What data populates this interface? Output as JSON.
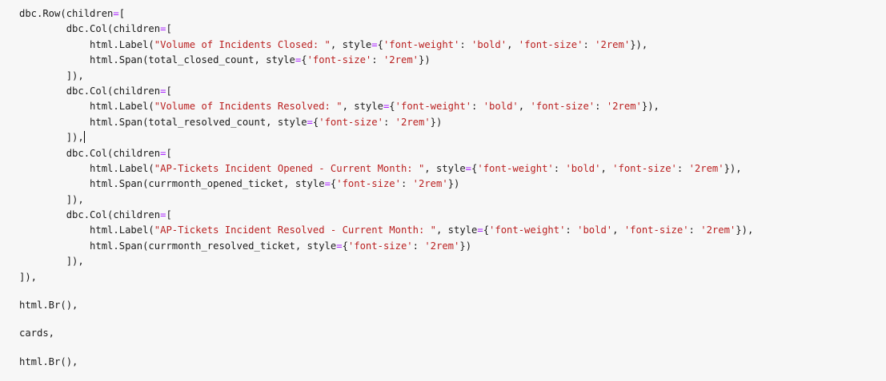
{
  "colors": {
    "background": "#f7f7f7",
    "text": "#1a1a1a",
    "string": "#ba2121",
    "operator": "#aa22ff"
  },
  "code_lines": [
    [
      {
        "t": "dbc.Row(children"
      },
      {
        "t": "=",
        "c": "op"
      },
      {
        "t": "["
      }
    ],
    [
      {
        "t": "        dbc.Col(children"
      },
      {
        "t": "=",
        "c": "op"
      },
      {
        "t": "["
      }
    ],
    [
      {
        "t": "            html.Label("
      },
      {
        "t": "\"Volume of Incidents Closed: \"",
        "c": "str"
      },
      {
        "t": ", style"
      },
      {
        "t": "=",
        "c": "op"
      },
      {
        "t": "{"
      },
      {
        "t": "'font-weight'",
        "c": "str"
      },
      {
        "t": ": "
      },
      {
        "t": "'bold'",
        "c": "str"
      },
      {
        "t": ", "
      },
      {
        "t": "'font-size'",
        "c": "str"
      },
      {
        "t": ": "
      },
      {
        "t": "'2rem'",
        "c": "str"
      },
      {
        "t": "}),"
      }
    ],
    [
      {
        "t": "            html.Span(total_closed_count, style"
      },
      {
        "t": "=",
        "c": "op"
      },
      {
        "t": "{"
      },
      {
        "t": "'font-size'",
        "c": "str"
      },
      {
        "t": ": "
      },
      {
        "t": "'2rem'",
        "c": "str"
      },
      {
        "t": "})"
      }
    ],
    [
      {
        "t": "        ]),"
      }
    ],
    [
      {
        "t": "        dbc.Col(children"
      },
      {
        "t": "=",
        "c": "op"
      },
      {
        "t": "["
      }
    ],
    [
      {
        "t": "            html.Label("
      },
      {
        "t": "\"Volume of Incidents Resolved: \"",
        "c": "str"
      },
      {
        "t": ", style"
      },
      {
        "t": "=",
        "c": "op"
      },
      {
        "t": "{"
      },
      {
        "t": "'font-weight'",
        "c": "str"
      },
      {
        "t": ": "
      },
      {
        "t": "'bold'",
        "c": "str"
      },
      {
        "t": ", "
      },
      {
        "t": "'font-size'",
        "c": "str"
      },
      {
        "t": ": "
      },
      {
        "t": "'2rem'",
        "c": "str"
      },
      {
        "t": "}),"
      }
    ],
    [
      {
        "t": "            html.Span(total_resolved_count, style"
      },
      {
        "t": "=",
        "c": "op"
      },
      {
        "t": "{"
      },
      {
        "t": "'font-size'",
        "c": "str"
      },
      {
        "t": ": "
      },
      {
        "t": "'2rem'",
        "c": "str"
      },
      {
        "t": "})"
      }
    ],
    [
      {
        "t": "        ]),"
      },
      {
        "caret": true
      }
    ],
    [
      {
        "t": "        dbc.Col(children"
      },
      {
        "t": "=",
        "c": "op"
      },
      {
        "t": "["
      }
    ],
    [
      {
        "t": "            html.Label("
      },
      {
        "t": "\"AP-Tickets Incident Opened - Current Month: \"",
        "c": "str"
      },
      {
        "t": ", style"
      },
      {
        "t": "=",
        "c": "op"
      },
      {
        "t": "{"
      },
      {
        "t": "'font-weight'",
        "c": "str"
      },
      {
        "t": ": "
      },
      {
        "t": "'bold'",
        "c": "str"
      },
      {
        "t": ", "
      },
      {
        "t": "'font-size'",
        "c": "str"
      },
      {
        "t": ": "
      },
      {
        "t": "'2rem'",
        "c": "str"
      },
      {
        "t": "}),"
      }
    ],
    [
      {
        "t": "            html.Span(currmonth_opened_ticket, style"
      },
      {
        "t": "=",
        "c": "op"
      },
      {
        "t": "{"
      },
      {
        "t": "'font-size'",
        "c": "str"
      },
      {
        "t": ": "
      },
      {
        "t": "'2rem'",
        "c": "str"
      },
      {
        "t": "})"
      }
    ],
    [
      {
        "t": "        ]),"
      }
    ],
    [
      {
        "t": "        dbc.Col(children"
      },
      {
        "t": "=",
        "c": "op"
      },
      {
        "t": "["
      }
    ],
    [
      {
        "t": "            html.Label("
      },
      {
        "t": "\"AP-Tickets Incident Resolved - Current Month: \"",
        "c": "str"
      },
      {
        "t": ", style"
      },
      {
        "t": "=",
        "c": "op"
      },
      {
        "t": "{"
      },
      {
        "t": "'font-weight'",
        "c": "str"
      },
      {
        "t": ": "
      },
      {
        "t": "'bold'",
        "c": "str"
      },
      {
        "t": ", "
      },
      {
        "t": "'font-size'",
        "c": "str"
      },
      {
        "t": ": "
      },
      {
        "t": "'2rem'",
        "c": "str"
      },
      {
        "t": "}),"
      }
    ],
    [
      {
        "t": "            html.Span(currmonth_resolved_ticket, style"
      },
      {
        "t": "=",
        "c": "op"
      },
      {
        "t": "{"
      },
      {
        "t": "'font-size'",
        "c": "str"
      },
      {
        "t": ": "
      },
      {
        "t": "'2rem'",
        "c": "str"
      },
      {
        "t": "})"
      }
    ],
    [
      {
        "t": "        ]),"
      }
    ],
    [
      {
        "t": "]),"
      }
    ],
    [],
    [
      {
        "t": "html.Br(),"
      }
    ],
    [],
    [
      {
        "t": "cards,"
      }
    ],
    [],
    [
      {
        "t": "html.Br(),"
      }
    ]
  ]
}
